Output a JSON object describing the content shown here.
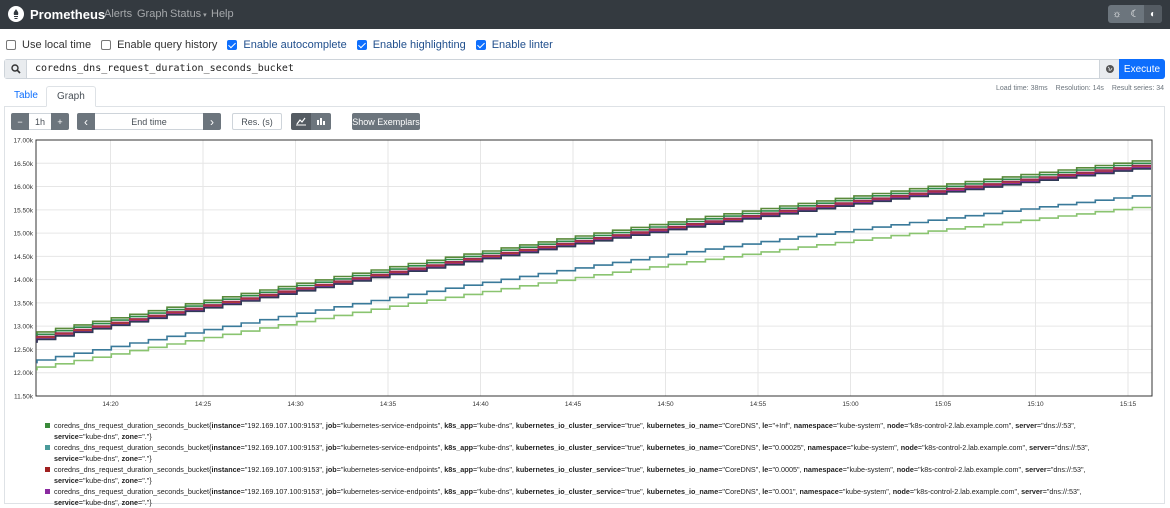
{
  "app": {
    "title": "Prometheus"
  },
  "nav": {
    "alerts": "Alerts",
    "graph": "Graph",
    "status": "Status",
    "help": "Help"
  },
  "options": [
    {
      "label": "Use local time",
      "checked": false
    },
    {
      "label": "Enable query history",
      "checked": false
    },
    {
      "label": "Enable autocomplete",
      "checked": true
    },
    {
      "label": "Enable highlighting",
      "checked": true
    },
    {
      "label": "Enable linter",
      "checked": true
    }
  ],
  "query": {
    "expression": "coredns_dns_request_duration_seconds_bucket",
    "execute_label": "Execute"
  },
  "stats": {
    "load_time": "Load time: 38ms",
    "resolution": "Resolution: 14s",
    "result_series": "Result series: 34"
  },
  "tabs": {
    "table": "Table",
    "graph": "Graph"
  },
  "controls": {
    "minus": "−",
    "range": "1h",
    "plus": "+",
    "prev": "‹",
    "end_time": "End time",
    "next": "›",
    "res": "Res. (s)",
    "exemplars": "Show Exemplars"
  },
  "icons": {
    "search": "search-icon",
    "globe": "globe-icon",
    "line_chart": "line-chart-icon",
    "stacked_chart": "stacked-chart-icon",
    "theme_light": "sun-icon",
    "theme_dark": "moon-icon",
    "theme_auto": "contrast-icon"
  },
  "chart_data": {
    "type": "line",
    "ylim": [
      11500,
      17000
    ],
    "yticks": [
      "11.50k",
      "12.00k",
      "12.50k",
      "13.00k",
      "13.50k",
      "14.00k",
      "14.50k",
      "15.00k",
      "15.50k",
      "16.00k",
      "16.50k",
      "17.00k"
    ],
    "xticks": [
      "14:20",
      "14:25",
      "14:30",
      "14:35",
      "14:40",
      "14:45",
      "14:50",
      "14:55",
      "15:00",
      "15:05",
      "15:10",
      "15:15"
    ],
    "grid": true,
    "series": [
      {
        "color": "#5a8a3a",
        "start": 12800,
        "end": 16550
      },
      {
        "color": "#2f8a4a",
        "start": 12750,
        "end": 16500
      },
      {
        "color": "#9a2a55",
        "start": 12700,
        "end": 16450
      },
      {
        "color": "#b03a3a",
        "start": 12680,
        "end": 16420
      },
      {
        "color": "#8a2aa0",
        "start": 12650,
        "end": 16400
      },
      {
        "color": "#2f3a55",
        "start": 12640,
        "end": 16380
      },
      {
        "color": "#3a7a9a",
        "start": 12200,
        "end": 15800
      },
      {
        "color": "#8ac470",
        "start": 12050,
        "end": 15550
      }
    ]
  },
  "legend": [
    {
      "color": "#3a8a3a",
      "metric": "coredns_dns_request_duration_seconds_bucket{",
      "labels": [
        [
          "instance",
          "\"192.169.107.100:9153\""
        ],
        [
          "job",
          "\"kubernetes-service-endpoints\""
        ],
        [
          "k8s_app",
          "\"kube-dns\""
        ],
        [
          "kubernetes_io_cluster_service",
          "\"true\""
        ],
        [
          "kubernetes_io_name",
          "\"CoreDNS\""
        ],
        [
          "le",
          "\"+Inf\""
        ],
        [
          "namespace",
          "\"kube-system\""
        ],
        [
          "node",
          "\"k8s-control-2.lab.example.com\""
        ],
        [
          "server",
          "\"dns://:53\""
        ],
        [
          "service",
          "\"kube-dns\""
        ],
        [
          "zone",
          "\".\""
        ]
      ]
    },
    {
      "color": "#4a9a9a",
      "metric": "coredns_dns_request_duration_seconds_bucket{",
      "labels": [
        [
          "instance",
          "\"192.169.107.100:9153\""
        ],
        [
          "job",
          "\"kubernetes-service-endpoints\""
        ],
        [
          "k8s_app",
          "\"kube-dns\""
        ],
        [
          "kubernetes_io_cluster_service",
          "\"true\""
        ],
        [
          "kubernetes_io_name",
          "\"CoreDNS\""
        ],
        [
          "le",
          "\"0.00025\""
        ],
        [
          "namespace",
          "\"kube-system\""
        ],
        [
          "node",
          "\"k8s-control-2.lab.example.com\""
        ],
        [
          "server",
          "\"dns://:53\""
        ],
        [
          "service",
          "\"kube-dns\""
        ],
        [
          "zone",
          "\".\""
        ]
      ]
    },
    {
      "color": "#a02020",
      "metric": "coredns_dns_request_duration_seconds_bucket{",
      "labels": [
        [
          "instance",
          "\"192.169.107.100:9153\""
        ],
        [
          "job",
          "\"kubernetes-service-endpoints\""
        ],
        [
          "k8s_app",
          "\"kube-dns\""
        ],
        [
          "kubernetes_io_cluster_service",
          "\"true\""
        ],
        [
          "kubernetes_io_name",
          "\"CoreDNS\""
        ],
        [
          "le",
          "\"0.0005\""
        ],
        [
          "namespace",
          "\"kube-system\""
        ],
        [
          "node",
          "\"k8s-control-2.lab.example.com\""
        ],
        [
          "server",
          "\"dns://:53\""
        ],
        [
          "service",
          "\"kube-dns\""
        ],
        [
          "zone",
          "\".\""
        ]
      ]
    },
    {
      "color": "#8a2aa0",
      "metric": "coredns_dns_request_duration_seconds_bucket{",
      "labels": [
        [
          "instance",
          "\"192.169.107.100:9153\""
        ],
        [
          "job",
          "\"kubernetes-service-endpoints\""
        ],
        [
          "k8s_app",
          "\"kube-dns\""
        ],
        [
          "kubernetes_io_cluster_service",
          "\"true\""
        ],
        [
          "kubernetes_io_name",
          "\"CoreDNS\""
        ],
        [
          "le",
          "\"0.001\""
        ],
        [
          "namespace",
          "\"kube-system\""
        ],
        [
          "node",
          "\"k8s-control-2.lab.example.com\""
        ],
        [
          "server",
          "\"dns://:53\""
        ],
        [
          "service",
          "\"kube-dns\""
        ],
        [
          "zone",
          "\".\""
        ]
      ]
    }
  ]
}
